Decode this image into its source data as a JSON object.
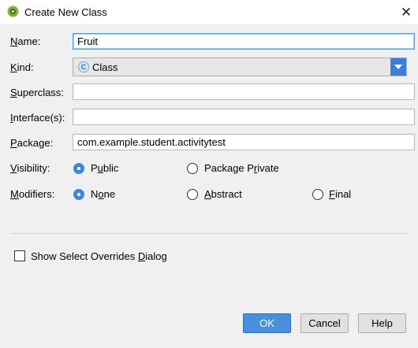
{
  "window": {
    "title": "Create New Class",
    "close_symbol": "✕"
  },
  "form": {
    "name": {
      "label_pre": "",
      "label_key": "N",
      "label_post": "ame:",
      "value": "Fruit"
    },
    "kind": {
      "label_pre": "",
      "label_key": "K",
      "label_post": "ind:",
      "value": "Class",
      "badge": "C",
      "icon": "class-icon"
    },
    "superclass": {
      "label_pre": "",
      "label_key": "S",
      "label_post": "uperclass:",
      "value": ""
    },
    "interfaces": {
      "label_pre": "",
      "label_key": "I",
      "label_post": "nterface(s):",
      "value": ""
    },
    "package": {
      "label_pre": "",
      "label_key": "P",
      "label_post": "ackage:",
      "value": "com.example.student.activitytest"
    },
    "visibility": {
      "label_pre": "",
      "label_key": "V",
      "label_post": "isibility:",
      "options": [
        {
          "pre": "P",
          "key": "u",
          "post": "blic",
          "selected": true
        },
        {
          "pre": "Package P",
          "key": "r",
          "post": "ivate",
          "selected": false
        }
      ]
    },
    "modifiers": {
      "label_pre": "",
      "label_key": "M",
      "label_post": "odifiers:",
      "options": [
        {
          "pre": "N",
          "key": "o",
          "post": "ne",
          "selected": true
        },
        {
          "pre": "",
          "key": "A",
          "post": "bstract",
          "selected": false
        },
        {
          "pre": "",
          "key": "F",
          "post": "inal",
          "selected": false
        }
      ]
    },
    "show_overrides": {
      "pre": "Show Select Overrides ",
      "key": "D",
      "post": "ialog",
      "checked": false
    }
  },
  "buttons": {
    "ok": "OK",
    "cancel": "Cancel",
    "help": "Help"
  },
  "colors": {
    "accent": "#3f87d9",
    "ok_button": "#4a8fdb",
    "dropdown_arrow": "#3d7fd6"
  }
}
